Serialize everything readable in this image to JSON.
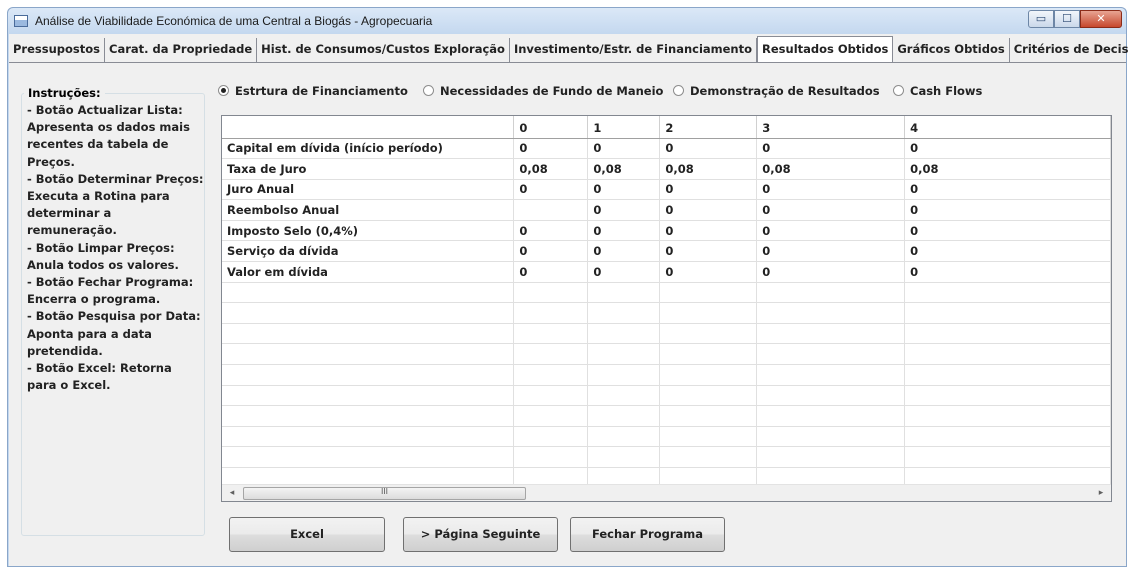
{
  "window": {
    "title": "Análise de Viabilidade Económica de uma Central a Biogás - Agropecuaria",
    "controls": {
      "minimize": "▭",
      "maximize": "☐",
      "close": "✕"
    }
  },
  "tabs": [
    {
      "label": "Pressupostos",
      "active": false
    },
    {
      "label": "Carat. da Propriedade",
      "active": false
    },
    {
      "label": "Hist. de Consumos/Custos Exploração",
      "active": false
    },
    {
      "label": "Investimento/Estr. de Financiamento",
      "active": false
    },
    {
      "label": "Resultados Obtidos",
      "active": true
    },
    {
      "label": "Gráficos Obtidos",
      "active": false
    },
    {
      "label": "Critérios de Decisão",
      "active": false
    }
  ],
  "instructions": {
    "legend": "Instruções:",
    "text": "- Botão Actualizar Lista: Apresenta os dados mais recentes da tabela de Preços.\n- Botão Determinar Preços: Executa a Rotina para determinar a remuneração.\n- Botão Limpar Preços: Anula todos os valores.\n- Botão Fechar Programa: Encerra o programa.\n- Botão Pesquisa por Data: Aponta para a data pretendida.\n- Botão Excel: Retorna para o Excel."
  },
  "radios": [
    {
      "label": "Estrtura de Financiamento",
      "checked": true
    },
    {
      "label": "Necessidades de Fundo de Maneio",
      "checked": false
    },
    {
      "label": "Demonstração de Resultados",
      "checked": false
    },
    {
      "label": "Cash Flows",
      "checked": false
    }
  ],
  "grid": {
    "columns": [
      "",
      "0",
      "1",
      "2",
      "3",
      "4"
    ],
    "rows": [
      {
        "label": "Capital em dívida (início período)",
        "values": [
          "0",
          "0",
          "0",
          "0",
          "0"
        ]
      },
      {
        "label": "Taxa de Juro",
        "values": [
          "0,08",
          "0,08",
          "0,08",
          "0,08",
          "0,08"
        ]
      },
      {
        "label": "Juro Anual",
        "values": [
          "0",
          "0",
          "0",
          "0",
          "0"
        ]
      },
      {
        "label": "Reembolso Anual",
        "values": [
          "",
          "0",
          "0",
          "0",
          "0"
        ]
      },
      {
        "label": "Imposto Selo (0,4%)",
        "values": [
          "0",
          "0",
          "0",
          "0",
          "0"
        ]
      },
      {
        "label": "Serviço da dívida",
        "values": [
          "0",
          "0",
          "0",
          "0",
          "0"
        ]
      },
      {
        "label": "Valor em dívida",
        "values": [
          "0",
          "0",
          "0",
          "0",
          "0"
        ]
      }
    ],
    "empty_rows": 10,
    "scroll": {
      "left": "◂",
      "right": "▸",
      "grip": "III"
    }
  },
  "buttons": {
    "excel": "Excel",
    "next_page": "> Página Seguinte",
    "close_program": "Fechar Programa"
  }
}
